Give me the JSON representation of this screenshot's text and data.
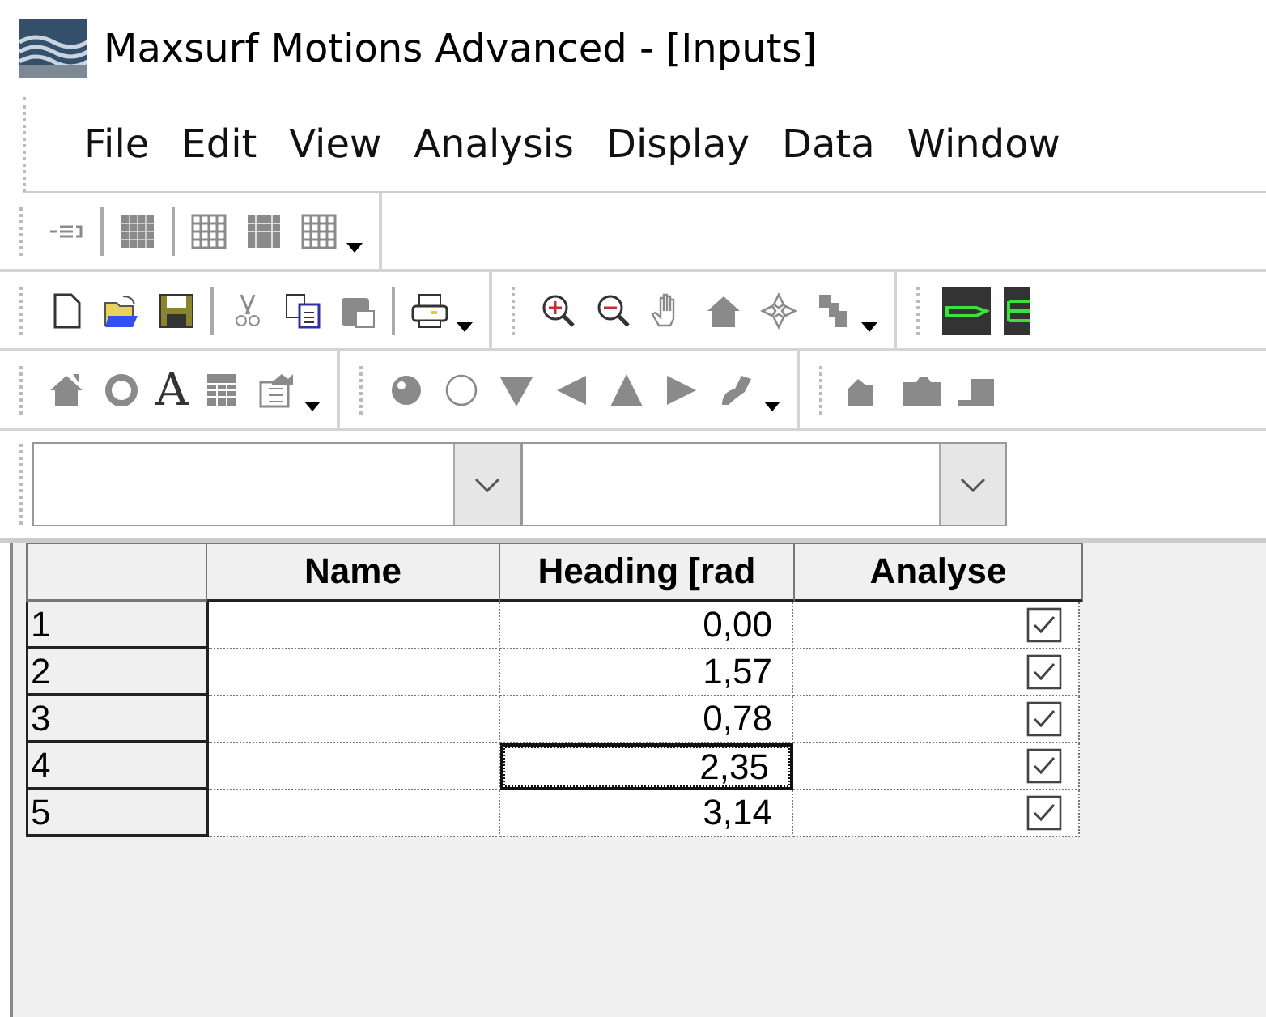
{
  "window": {
    "title": "Maxsurf Motions Advanced - [Inputs]"
  },
  "menu": [
    "File",
    "Edit",
    "View",
    "Analysis",
    "Display",
    "Data",
    "Window"
  ],
  "toolbar": {
    "text_tool_glyph": "A"
  },
  "table": {
    "columns": [
      "Name",
      "Heading [rad",
      "Analyse"
    ],
    "rows": [
      {
        "index": "1",
        "name": "",
        "heading": "0,00",
        "analyse": true,
        "focused": false
      },
      {
        "index": "2",
        "name": "",
        "heading": "1,57",
        "analyse": true,
        "focused": false
      },
      {
        "index": "3",
        "name": "",
        "heading": "0,78",
        "analyse": true,
        "focused": false
      },
      {
        "index": "4",
        "name": "",
        "heading": "2,35",
        "analyse": true,
        "focused": true
      },
      {
        "index": "5",
        "name": "",
        "heading": "3,14",
        "analyse": true,
        "focused": false
      }
    ]
  }
}
